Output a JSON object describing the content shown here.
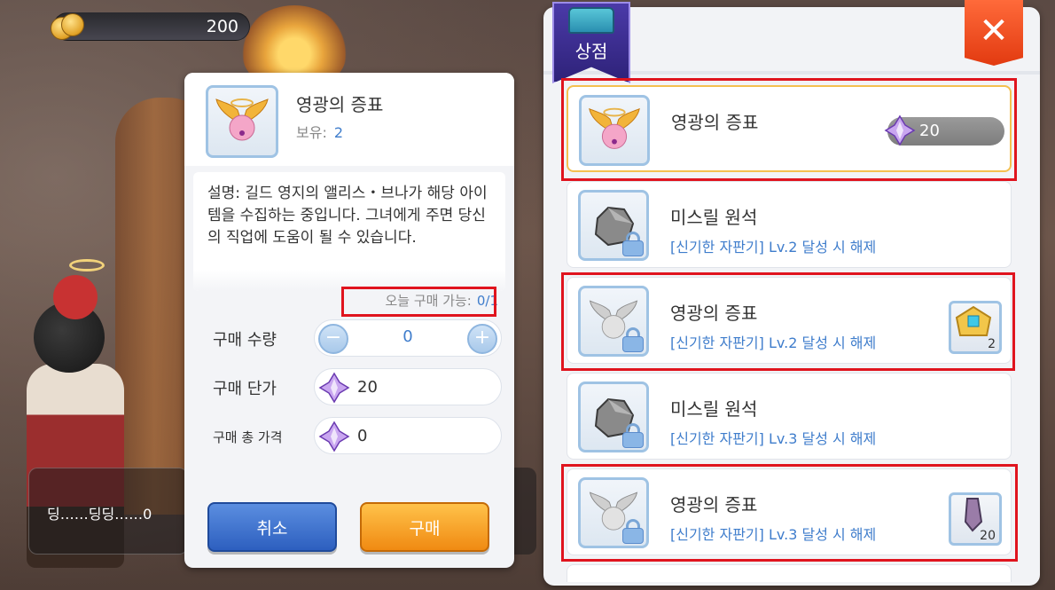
{
  "currency": {
    "value": "200",
    "icon": "gold-coin-icon"
  },
  "background": {
    "dialog_text": "딩……딩딩……0"
  },
  "detail": {
    "item_name": "영광의 증표",
    "owned_label": "보유:",
    "owned_value": "2",
    "description": "설명: 길드 영지의 앨리스・브나가 해당 아이템을 수집하는 중입니다. 그녀에게 주면 당신의 직업에 도움이 될 수 있습니다.",
    "daily_limit_label": "오늘 구매 가능:",
    "daily_limit_value": "0/1",
    "quantity_label": "구매 수량",
    "quantity_value": "0",
    "unit_price_label": "구매 단가",
    "unit_price_value": "20",
    "total_price_label": "구매 총 가격",
    "total_price_value": "0",
    "cancel_label": "취소",
    "buy_label": "구매"
  },
  "shop": {
    "title": "상점",
    "close_icon": "close-icon",
    "items": [
      {
        "name": "영광의 증표",
        "price": "20",
        "locked": false,
        "selected": true
      },
      {
        "name": "미스릴 원석",
        "unlock": "[신기한 자판기] Lv.2 달성 시 해제",
        "locked": true
      },
      {
        "name": "영광의 증표",
        "unlock": "[신기한 자판기] Lv.2 달성 시 해제",
        "locked": true,
        "reward_count": "2"
      },
      {
        "name": "미스릴 원석",
        "unlock": "[신기한 자판기] Lv.3 달성 시 해제",
        "locked": true
      },
      {
        "name": "영광의 증표",
        "unlock": "[신기한 자판기] Lv.3 달성 시 해제",
        "locked": true,
        "reward_count": "20"
      }
    ]
  },
  "colors": {
    "accent_blue": "#3f7dcc",
    "annotation_red": "#e0141e",
    "buy_orange": "#f08a12",
    "cancel_blue": "#2d5fbf"
  }
}
